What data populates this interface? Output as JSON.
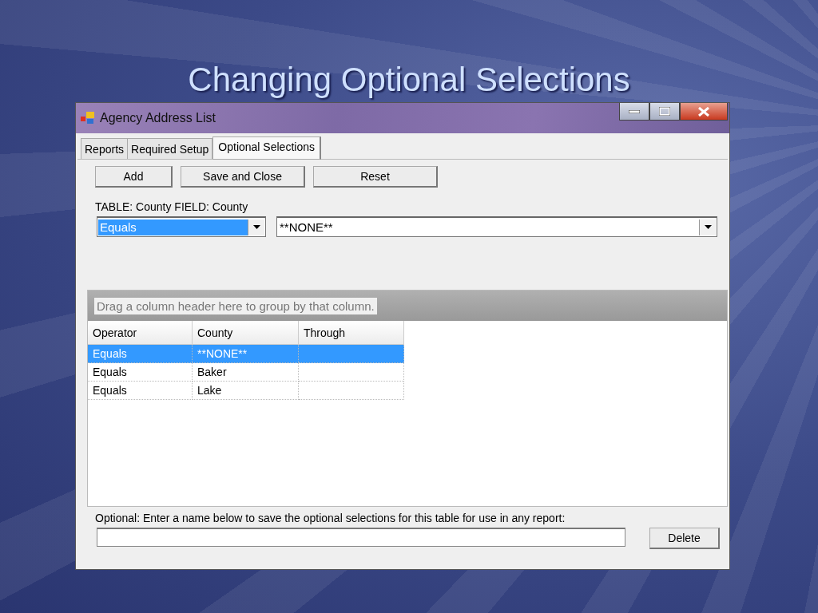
{
  "slide": {
    "title": "Changing Optional Selections"
  },
  "window": {
    "title": "Agency Address List"
  },
  "tabs": [
    {
      "label": "Reports",
      "selected": false
    },
    {
      "label": "Required Setup",
      "selected": false
    },
    {
      "label": "Optional Selections",
      "selected": true
    }
  ],
  "buttons": [
    "Add",
    "Save and Close",
    "Reset"
  ],
  "filter_label": "TABLE: County FIELD: County",
  "operator_dropdown": {
    "value": "Equals",
    "highlighted": true
  },
  "value_dropdown": {
    "value": "**NONE**",
    "highlighted": false
  },
  "grid": {
    "group_hint": "Drag a column header here to group by that column.",
    "columns": [
      "Operator",
      "County",
      "Through"
    ],
    "rows": [
      {
        "cells": [
          "Equals",
          "**NONE**"
        ],
        "selected": true
      },
      {
        "cells": [
          "Equals",
          "Baker"
        ],
        "selected": false
      },
      {
        "cells": [
          "Equals",
          "Lake"
        ],
        "selected": false
      }
    ]
  },
  "save_label": "Optional: Enter a name below to save the optional selections for this table for use in any report:",
  "delete_button": "Delete"
}
